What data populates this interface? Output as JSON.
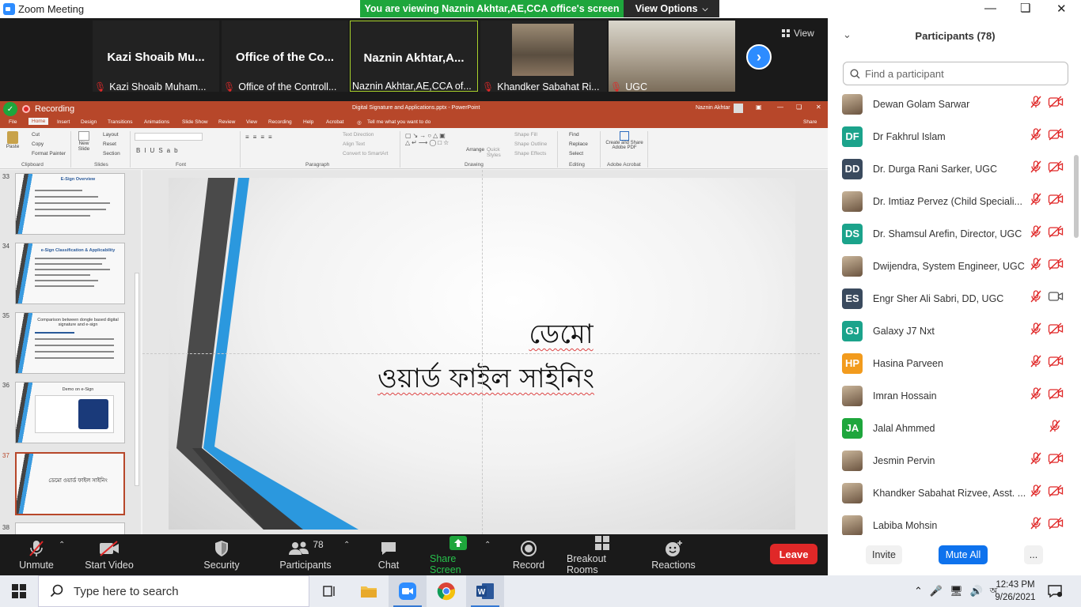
{
  "window": {
    "title": "Zoom Meeting",
    "viewing_banner": "You are viewing Naznin Akhtar,AE,CCA office's screen",
    "view_options": "View Options"
  },
  "video_strip": {
    "tiles": [
      {
        "big": "Kazi Shoaib Mu...",
        "name": "Kazi Shoaib Muham..."
      },
      {
        "big": "Office of the Co...",
        "name": "Office of the Controll..."
      },
      {
        "big": "Naznin Akhtar,A...",
        "name": "Naznin Akhtar,AE,CCA of..."
      },
      {
        "big": "",
        "name": "Khandker Sabahat Ri..."
      },
      {
        "big": "",
        "name": "UGC"
      }
    ],
    "view_label": "View"
  },
  "powerpoint": {
    "recording_label": "Recording",
    "file_title": "Digital Signature and Applications.pptx - PowerPoint",
    "user": "Naznin Akhtar",
    "tabs": [
      "File",
      "Home",
      "Insert",
      "Design",
      "Transitions",
      "Animations",
      "Slide Show",
      "Review",
      "View",
      "Recording",
      "Help",
      "Acrobat",
      "Tell me what you want to do"
    ],
    "share": "Share",
    "ribbon": {
      "clipboard": {
        "label": "Clipboard",
        "paste": "Paste",
        "cut": "Cut",
        "copy": "Copy",
        "format_painter": "Format Painter"
      },
      "slides": {
        "label": "Slides",
        "new_slide": "New Slide",
        "layout": "Layout",
        "reset": "Reset",
        "section": "Section"
      },
      "font": {
        "label": "Font"
      },
      "paragraph": {
        "label": "Paragraph",
        "text_direction": "Text Direction",
        "align_text": "Align Text",
        "convert": "Convert to SmartArt"
      },
      "drawing": {
        "label": "Drawing",
        "arrange": "Arrange",
        "quick_styles": "Quick Styles",
        "shape_fill": "Shape Fill",
        "shape_outline": "Shape Outline",
        "shape_effects": "Shape Effects"
      },
      "editing": {
        "label": "Editing",
        "find": "Find",
        "replace": "Replace",
        "select": "Select"
      },
      "acrobat": {
        "label": "Adobe Acrobat",
        "create": "Create and Share Adobe PDF"
      }
    },
    "thumbnails": [
      {
        "num": "33",
        "title": "E-Sign Overview"
      },
      {
        "num": "34",
        "title": "e-Sign Classification & Applicability"
      },
      {
        "num": "35",
        "title": "Comparison between dongle based digital signature and e-sign"
      },
      {
        "num": "36",
        "title": "Demo on e-Sign"
      },
      {
        "num": "37",
        "title": "ডেমো ওয়ার্ড ফাইল সাইনিং"
      },
      {
        "num": "38",
        "title": ""
      }
    ],
    "slide": {
      "line1": "ডেমো",
      "line2": "ওয়ার্ড ফাইল সাইনিং"
    }
  },
  "toolbar": {
    "unmute": "Unmute",
    "start_video": "Start Video",
    "security": "Security",
    "participants": "Participants",
    "participants_count": "78",
    "chat": "Chat",
    "share_screen": "Share Screen",
    "record": "Record",
    "breakout_rooms": "Breakout Rooms",
    "reactions": "Reactions",
    "leave": "Leave"
  },
  "participants_panel": {
    "title": "Participants (78)",
    "search_placeholder": "Find a participant",
    "participants": [
      {
        "initials": "",
        "color": "#d9662d",
        "name": "Dewan Golam Sarwar",
        "cam": "off"
      },
      {
        "initials": "DF",
        "color": "#1ba38b",
        "name": "Dr Fakhrul Islam",
        "cam": "off"
      },
      {
        "initials": "DD",
        "color": "#3a4a5e",
        "name": "Dr. Durga Rani Sarker, UGC",
        "cam": "off"
      },
      {
        "initials": "",
        "color": "#7a6a55",
        "name": "Dr. Imtiaz Pervez (Child Speciali...",
        "cam": "off"
      },
      {
        "initials": "DS",
        "color": "#1ba38b",
        "name": "Dr. Shamsul Arefin, Director, UGC",
        "cam": "off"
      },
      {
        "initials": "",
        "color": "#7a6a55",
        "name": "Dwijendra, System Engineer, UGC",
        "cam": "off"
      },
      {
        "initials": "ES",
        "color": "#3a4a5e",
        "name": "Engr Sher Ali Sabri, DD, UGC",
        "cam": "on"
      },
      {
        "initials": "GJ",
        "color": "#1ba38b",
        "name": "Galaxy J7 Nxt",
        "cam": "off"
      },
      {
        "initials": "HP",
        "color": "#f29b1d",
        "name": "Hasina Parveen",
        "cam": "off"
      },
      {
        "initials": "",
        "color": "#7a6a55",
        "name": "Imran Hossain",
        "cam": "off"
      },
      {
        "initials": "JA",
        "color": "#1ea63c",
        "name": "Jalal Ahmmed",
        "cam": "none"
      },
      {
        "initials": "",
        "color": "#a08070",
        "name": "Jesmin Pervin",
        "cam": "off"
      },
      {
        "initials": "",
        "color": "#7a6a55",
        "name": "Khandker Sabahat Rizvee, Asst. ...",
        "cam": "off"
      },
      {
        "initials": "",
        "color": "#6a4a3a",
        "name": "Labiba Mohsin",
        "cam": "off"
      }
    ],
    "invite": "Invite",
    "mute_all": "Mute All",
    "more": "..."
  },
  "taskbar": {
    "search_placeholder": "Type here to search",
    "time": "12:43 PM",
    "date": "9/26/2021"
  }
}
